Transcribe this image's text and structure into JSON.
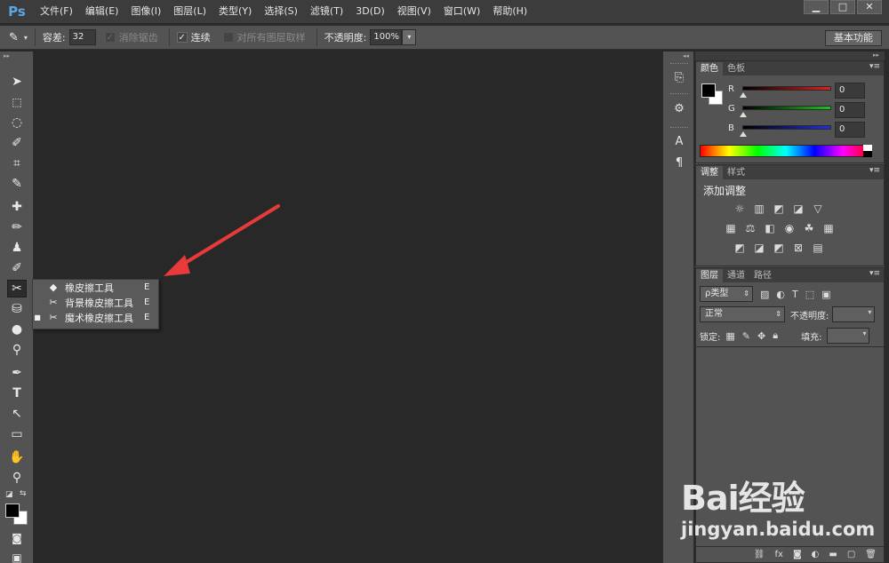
{
  "app": {
    "logo": "Ps"
  },
  "menu": [
    "文件(F)",
    "编辑(E)",
    "图像(I)",
    "图层(L)",
    "类型(Y)",
    "选择(S)",
    "滤镜(T)",
    "3D(D)",
    "视图(V)",
    "窗口(W)",
    "帮助(H)"
  ],
  "window_controls": {
    "minimize": "▁",
    "restore": "□",
    "close": "✕"
  },
  "options": {
    "tolerance_label": "容差:",
    "tolerance_value": "32",
    "antialias_label": "消除锯齿",
    "contiguous_label": "连续",
    "sample_all_label": "对所有图层取样",
    "opacity_label": "不透明度:",
    "opacity_value": "100%",
    "workspace_label": "基本功能"
  },
  "flyout": {
    "items": [
      {
        "label": "橡皮擦工具",
        "key": "E",
        "selected": false
      },
      {
        "label": "背景橡皮擦工具",
        "key": "E",
        "selected": false
      },
      {
        "label": "魔术橡皮擦工具",
        "key": "E",
        "selected": true
      }
    ]
  },
  "color_panel": {
    "tabs": [
      "颜色",
      "色板"
    ],
    "channels": [
      {
        "label": "R",
        "value": "0",
        "color": "#e02020"
      },
      {
        "label": "G",
        "value": "0",
        "color": "#20c020"
      },
      {
        "label": "B",
        "value": "0",
        "color": "#2030e0"
      }
    ]
  },
  "adjust_panel": {
    "tabs": [
      "调整",
      "样式"
    ],
    "title": "添加调整"
  },
  "layers_panel": {
    "tabs": [
      "图层",
      "通道",
      "路径"
    ],
    "filter_label": "ρ类型",
    "blend_mode": "正常",
    "opacity_label": "不透明度:",
    "lock_label": "锁定:",
    "fill_label": "填充:"
  },
  "watermark": {
    "logo": "Bai经验",
    "url": "jingyan.baidu.com"
  }
}
